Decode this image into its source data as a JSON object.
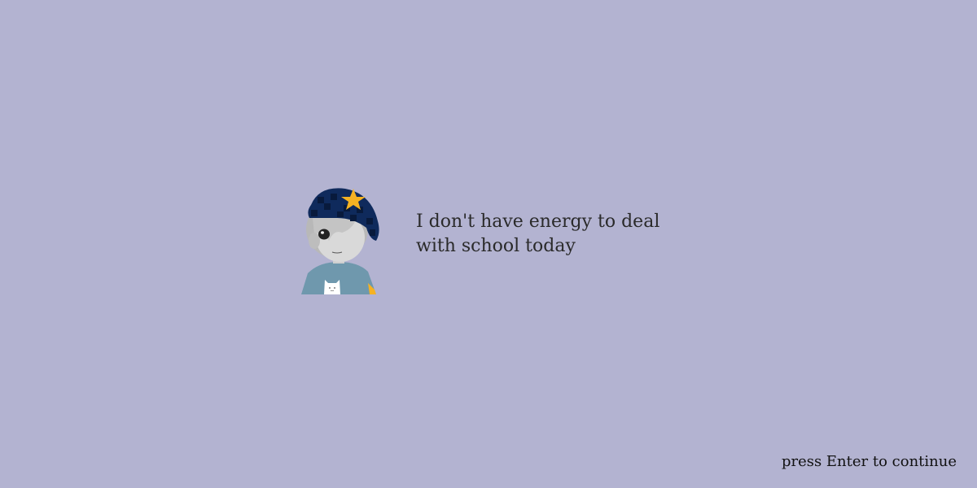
{
  "dialogue": {
    "speaker_portrait": "sleepy-kid-with-star-beanie",
    "text": "I don't have energy to deal with school today"
  },
  "prompt": {
    "text": "press Enter to continue"
  },
  "colors": {
    "background": "#b3b3d1",
    "text": "#2a2a2a",
    "beanie": "#0f2a5c",
    "star": "#f5b223",
    "shirt": "#6f98ad"
  }
}
